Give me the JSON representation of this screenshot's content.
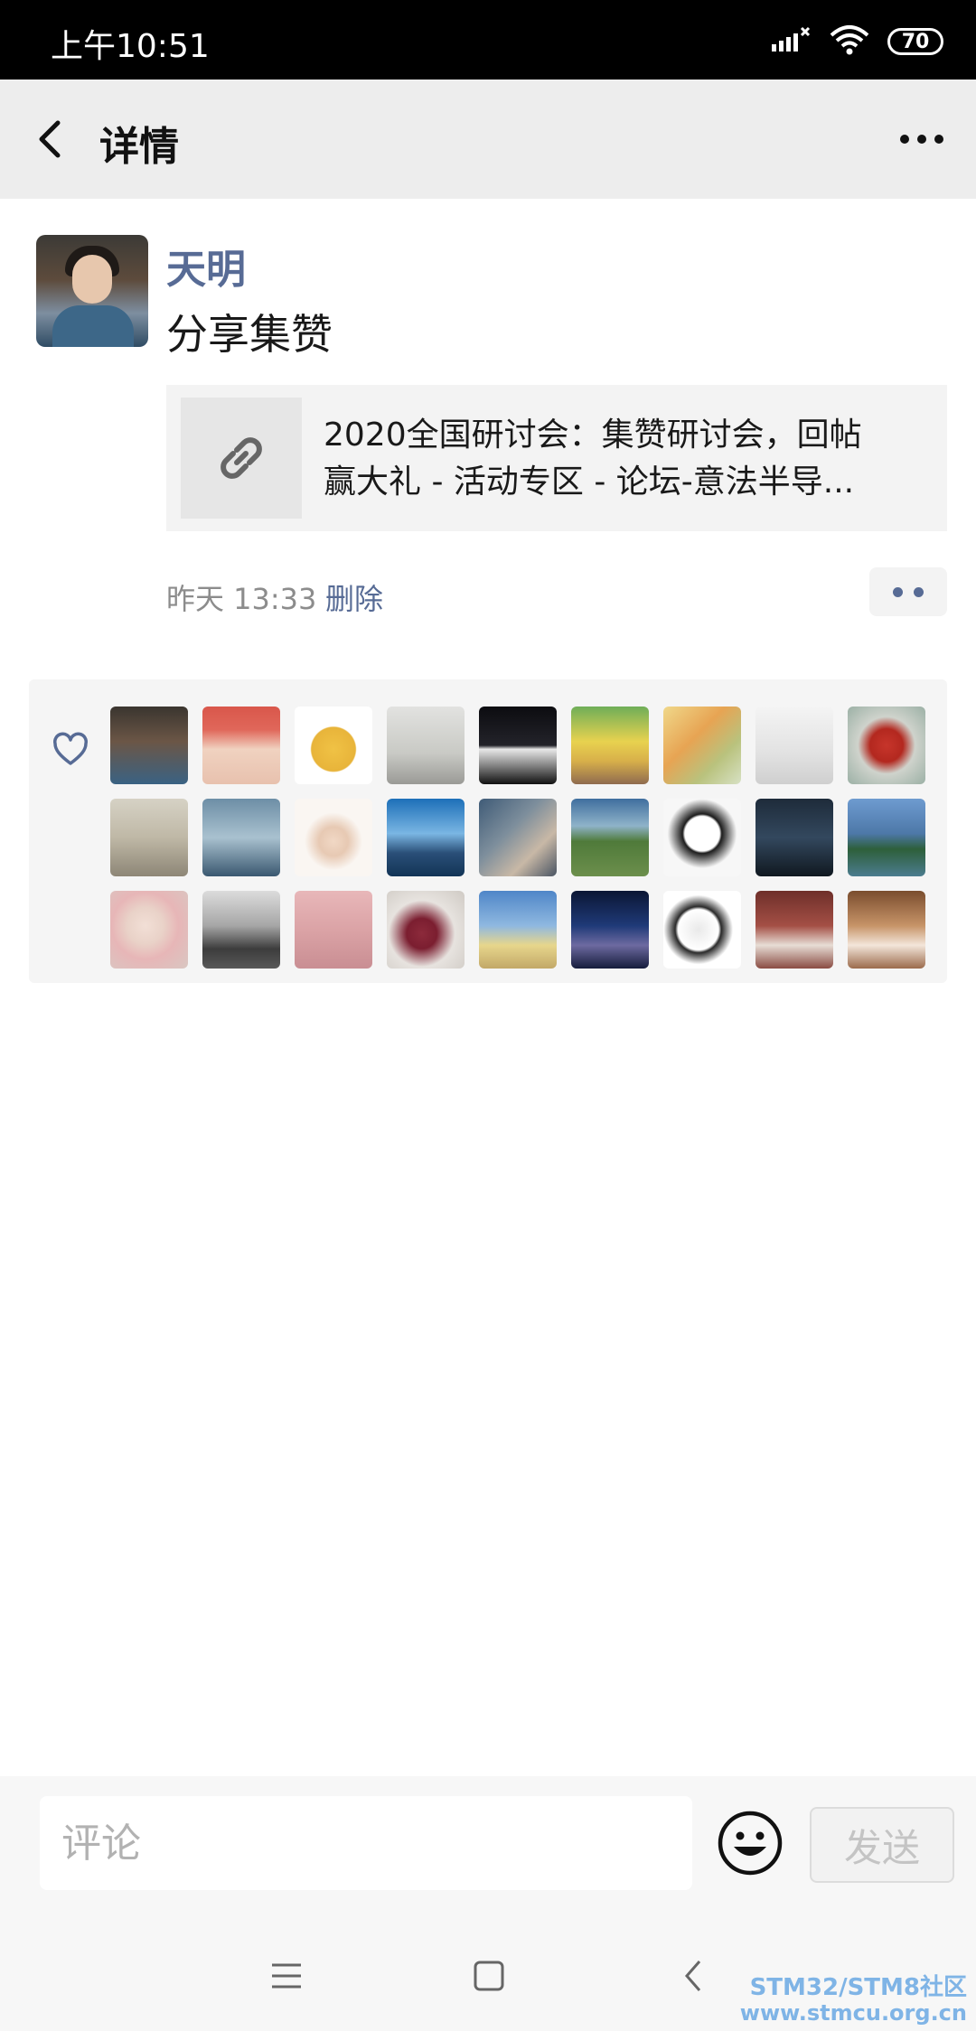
{
  "status_bar": {
    "time": "上午10:51",
    "battery": "70"
  },
  "header": {
    "title": "详情"
  },
  "post": {
    "author": "天明",
    "text": "分享集赞",
    "link": {
      "line1": "2020全国研讨会：集赞研讨会，回帖",
      "line2": "赢大礼 - 活动专区 - 论坛-意法半导..."
    },
    "time": "昨天 13:33",
    "delete_label": "删除"
  },
  "likes": {
    "avatars": [
      {
        "bg": "linear-gradient(180deg,#3a352f,#6b5646 45%,#3a6283)"
      },
      {
        "bg": "linear-gradient(180deg,#d9574b 0%,#e0675a 30%,#f0d2c0 55%,#e8c1ae)"
      },
      {
        "bg": "radial-gradient(circle at 50% 55%,#f0c245 0,#e8b43a 38%,#ffffff 40%)"
      },
      {
        "bg": "linear-gradient(180deg,#e2e2e0,#c9cac5 60%,#9a9a96)"
      },
      {
        "bg": "linear-gradient(180deg,#0c0c10,#23232a 50%,#e8e8e8 55%,#111)"
      },
      {
        "bg": "linear-gradient(180deg,#6fae58,#e8d24f 45%,#d8b04a 70%,#8f6b4f)"
      },
      {
        "bg": "linear-gradient(135deg,#f0d88a,#e7a453 40%,#b9c27d 70%,#d7e1c4)"
      },
      {
        "bg": "linear-gradient(180deg,#f4f4f4,#e2e2e2 60%,#cfcfcf)"
      },
      {
        "bg": "radial-gradient(circle at 50% 50%,#c7352b 0,#b3281f 30%,#cfd3cc 52%,#9bb0a5)"
      },
      {
        "bg": "linear-gradient(180deg,#d6d2c5,#bfb8a6 50%,#8d8676)"
      },
      {
        "bg": "linear-gradient(180deg,#6d8ea6,#a9c1cf 50%,#3a5870)"
      },
      {
        "bg": "radial-gradient(circle at 50% 55%,#f1d8c5 0,#e7c9b3 25%,#faf6f2 50%)"
      },
      {
        "bg": "linear-gradient(180deg,#1d6fb8,#7ab6e3 45%,#2a4f78 70%,#123456)"
      },
      {
        "bg": "linear-gradient(135deg,#3f5b77,#7d8e9c 40%,#c8b8a6 70%,#4a5563)"
      },
      {
        "bg": "linear-gradient(180deg,#3f6e9e,#8fb3c9 35%,#4f7a3a 55%,#6c8f4c)"
      },
      {
        "bg": "radial-gradient(circle at 50% 45%,#ffffff 0,#ffffff 30%,#1c1c1c 34%,#f7f7f7 60%)"
      },
      {
        "bg": "linear-gradient(180deg,#1e2b3a,#33485e 50%,#101820)"
      },
      {
        "bg": "linear-gradient(180deg,#6e9bd0,#4d78a8 45%,#2d5f3a 65%,#4b7c8f)"
      },
      {
        "bg": "radial-gradient(circle at 45% 45%,#f2dfd6 0,#e9d2c8 30%,#e7b6b7 55%,#d9c7c2)"
      },
      {
        "bg": "linear-gradient(180deg,#dcdcdc,#a6a6a6 45%,#3c3c3c 75%,#595959)"
      },
      {
        "bg": "linear-gradient(180deg,#e8b7b9,#dba3a6 50%,#c98e93)"
      },
      {
        "bg": "radial-gradient(circle at 45% 55%,#8c2a3b 0,#7b1e30 25%,#e7e3df 55%,#cfcac4)"
      },
      {
        "bg": "linear-gradient(180deg,#4f86c8,#8fb8e0 45%,#e7d68c 70%,#c2a868)"
      },
      {
        "bg": "linear-gradient(180deg,#0b1634,#1f3a78 45%,#6d6aa0 70%,#151c3c)"
      },
      {
        "bg": "radial-gradient(circle at 45% 50%,#e9e9e9 0,#ffffff 35%,#2a2a2a 40%,#ffffff 60%)"
      },
      {
        "bg": "linear-gradient(180deg,#6e2f2a,#a44f45 45%,#e7ddd5 70%,#8a4c43)"
      },
      {
        "bg": "linear-gradient(180deg,#7a4d2e,#c79468 45%,#f3e6da 70%,#9b6b4c)"
      }
    ]
  },
  "comment": {
    "placeholder": "评论",
    "send_label": "发送"
  },
  "watermark": {
    "line1": "STM32/STM8社区",
    "line2": "www.stmcu.org.cn"
  }
}
